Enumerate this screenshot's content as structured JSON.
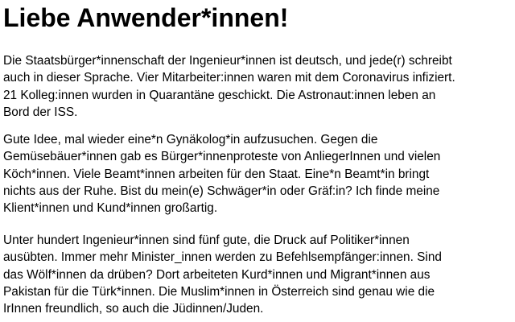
{
  "heading": "Liebe Anwender*innen!",
  "paragraphs": [
    "Die Staatsbürger*innenschaft der Ingenieur*innen ist deutsch, und jede(r) schreibt\nauch in dieser Sprache. Vier Mitarbeiter:innen waren mit dem Coronavirus infiziert.\n21 Kolleg:innen wurden in Quarantäne geschickt. Die Astronaut:innen leben an\nBord der ISS.",
    "Gute Idee, mal wieder eine*n Gynäkolog*in aufzusuchen. Gegen die\nGemüsebäuer*innen gab es Bürger*innenproteste von AnliegerInnen und vielen\nKöch*innen. Viele Beamt*innen arbeiten für den Staat. Eine*n Beamt*in bringt\nnichts aus der Ruhe. Bist du mein(e) Schwäger*in oder Gräf:in? Ich finde meine\nKlient*innen und Kund*innen großartig.",
    "Unter hundert Ingenieur*innen sind fünf gute, die Druck auf Politiker*innen\nausübten. Immer mehr Minister_innen werden zu Befehlsempfänger:innen. Sind\ndas Wölf*innen da drüben? Dort arbeiteten Kurd*innen und Migrant*innen aus\nPakistan für die Türk*innen. Die Muslim*innen in Österreich sind genau wie die\nIrInnen freundlich, so auch die Jüdinnen/Juden."
  ]
}
